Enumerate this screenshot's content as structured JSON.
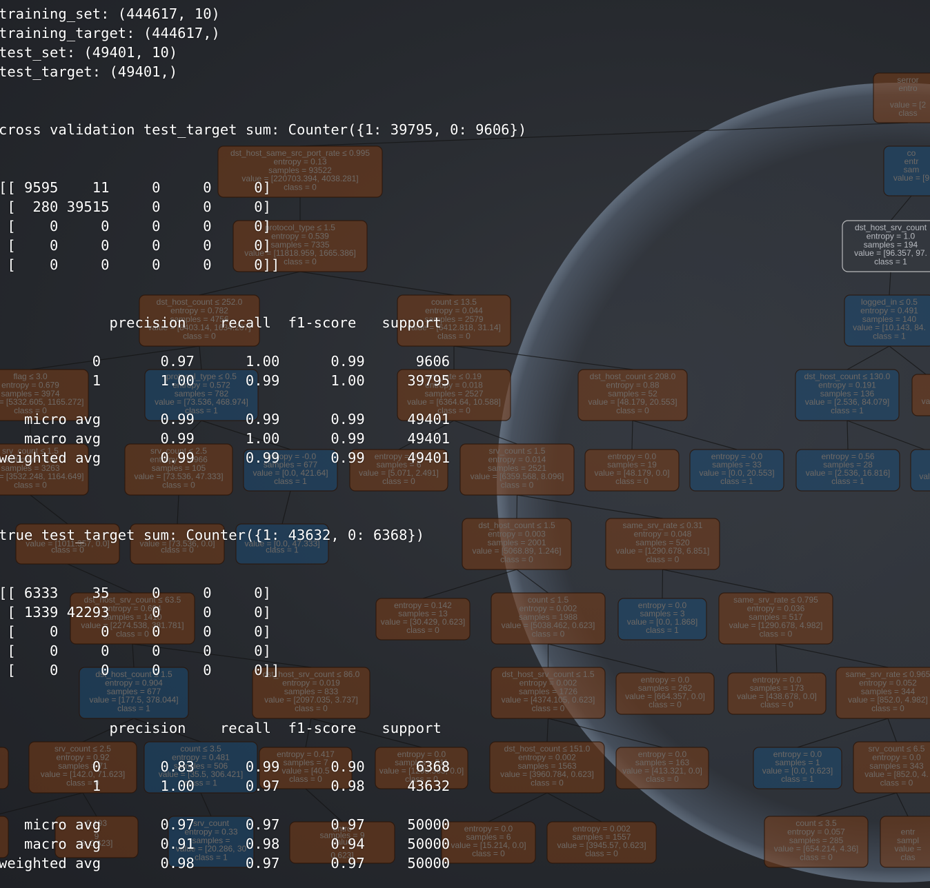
{
  "terminal": {
    "lines": [
      "training_set: (444617, 10)",
      "training_target: (444617,)",
      "test_set: (49401, 10)",
      "test_target: (49401,)",
      "",
      "",
      "cross validation test_target sum: Counter({1: 39795, 0: 9606})",
      "",
      "",
      "[[ 9595    11     0     0     0]",
      " [  280 39515     0     0     0]",
      " [    0     0     0     0     0]",
      " [    0     0     0     0     0]",
      " [    0     0     0     0     0]]",
      "",
      "",
      "             precision    recall  f1-score   support",
      "",
      "           0       0.97      1.00      0.99      9606",
      "           1       1.00      0.99      1.00     39795",
      "",
      "   micro avg       0.99      0.99      0.99     49401",
      "   macro avg       0.99      1.00      0.99     49401",
      "weighted avg       0.99      0.99      0.99     49401",
      "",
      "",
      "",
      "true test_target sum: Counter({1: 43632, 0: 6368})",
      "",
      "",
      "[[ 6333    35     0     0     0]",
      " [ 1339 42293     0     0     0]",
      " [    0     0     0     0     0]",
      " [    0     0     0     0     0]",
      " [    0     0     0     0     0]]",
      "",
      "",
      "             precision    recall  f1-score   support",
      "",
      "           0       0.83      0.99      0.90      6368",
      "           1       1.00      0.97      0.98     43632",
      "",
      "   micro avg       0.97      0.97      0.97     50000",
      "   macro avg       0.91      0.98      0.94     50000",
      "weighted avg       0.98      0.97      0.97     50000"
    ]
  },
  "colors": {
    "background": "#23262b",
    "text": "#ffffff",
    "node_orange": "#7a3d16",
    "node_blue": "#1c4a72",
    "node_white": "#dcdcdc",
    "edge": "#141414"
  },
  "background_tree": {
    "nodes": [
      {
        "color": "orange",
        "lines": [
          "serror",
          "entro",
          "",
          "value = [2",
          "class"
        ]
      },
      {
        "color": "orange",
        "lines": [
          "dst_host_same_src_port_rate ≤ 0.995",
          "entropy = 0.13",
          "samples = 93522",
          "value = [220703.394, 4038.281]",
          "class = 0"
        ]
      },
      {
        "color": "blue",
        "lines": [
          "co",
          "entr",
          "sam",
          "value = [9",
          ""
        ]
      },
      {
        "color": "orange",
        "lines": [
          "protocol_type ≤ 1.5",
          "entropy = 0.539",
          "samples = 7335",
          "value = [11818.959, 1665.386]",
          "class = 0"
        ]
      },
      {
        "color": "white",
        "lines": [
          "dst_host_srv_count",
          "entropy = 1.0",
          "samples = 194",
          "value = [96.357, 97.",
          "class = 1"
        ]
      },
      {
        "color": "orange",
        "lines": [
          "dst_host_count ≤ 252.0",
          "entropy = 0.782",
          "samples = 4756",
          "value = [8403.14, 1634.207]",
          "class = 0"
        ]
      },
      {
        "color": "orange",
        "lines": [
          "count ≤ 13.5",
          "entropy = 0.044",
          "samples = 2579",
          "value = [6412.818, 31.14]",
          "class = 0"
        ]
      },
      {
        "color": "blue",
        "lines": [
          "logged_in ≤ 0.5",
          "entropy = 0.491",
          "samples = 140",
          "value = [10.143, 84.",
          "class = 1"
        ]
      },
      {
        "color": "orange",
        "lines": [
          "flag ≤ 3.0",
          "entropy = 0.679",
          "samples = 3974",
          "value = [5332.605, 1165.272]",
          "class = 0"
        ]
      },
      {
        "color": "blue",
        "lines": [
          "protocol_type ≤ 0.5",
          "entropy = 0.572",
          "samples = 782",
          "value = [73.536, 468.974]",
          "class = 1"
        ]
      },
      {
        "color": "orange",
        "lines": [
          "srv_rate ≤ 0.19",
          "entropy = 0.018",
          "samples = 2527",
          "value = [6364.64, 10.588]",
          "class = 0"
        ]
      },
      {
        "color": "orange",
        "lines": [
          "dst_host_count ≤ 208.0",
          "entropy = 0.88",
          "samples = 52",
          "value = [48.179, 20.553]",
          "class = 0"
        ]
      },
      {
        "color": "blue",
        "lines": [
          "dst_host_count ≤ 130.0",
          "entropy = 0.191",
          "samples = 136",
          "value = [2.536, 84.079]",
          "class = 1"
        ]
      },
      {
        "color": "orange",
        "lines": [
          "",
          "",
          "",
          "va",
          ""
        ]
      },
      {
        "color": "orange",
        "lines": [
          "srv_count ≤ 1.5",
          "entropy = 0.5",
          "samples = 3263",
          "value = [3532.248, 1164.649]",
          "class = 0"
        ]
      },
      {
        "color": "orange",
        "lines": [
          "srv_count ≤ 2.5",
          "entropy = 0.966",
          "samples = 105",
          "value = [73.536, 47.333]",
          "class = 0"
        ]
      },
      {
        "color": "blue",
        "lines": [
          "entropy = -0.0",
          "samples = 677",
          "value = [0.0, 421.64]",
          "class = 1"
        ]
      },
      {
        "color": "orange",
        "lines": [
          "entropy = 0.0",
          "samples = 6",
          "value = [5.071, 2.491]",
          "class = 0"
        ]
      },
      {
        "color": "orange",
        "lines": [
          "srv_count ≤ 1.5",
          "entropy = 0.014",
          "samples = 2521",
          "value = [6359.568, 8.096]",
          "class = 0"
        ]
      },
      {
        "color": "orange",
        "lines": [
          "entropy = 0.0",
          "samples = 19",
          "value = [48.179, 0.0]",
          "class = 0"
        ]
      },
      {
        "color": "blue",
        "lines": [
          "entropy = -0.0",
          "samples = 33",
          "value = [0.0, 20.553]",
          "class = 1"
        ]
      },
      {
        "color": "blue",
        "lines": [
          "entropy = 0.56",
          "samples = 28",
          "value = [2.536, 16.816]",
          "class = 1"
        ]
      },
      {
        "color": "blue",
        "lines": [
          "",
          "",
          "",
          "val",
          ""
        ]
      },
      {
        "color": "orange",
        "lines": [
          "",
          "",
          "value = [1011.357, 0.0]",
          "class = 0",
          ""
        ]
      },
      {
        "color": "orange",
        "lines": [
          "",
          "",
          "value = [73.536, 0.0]",
          "class = 0",
          ""
        ]
      },
      {
        "color": "blue",
        "lines": [
          "",
          "",
          "value = [0.0, 47.333]",
          "class = 1",
          ""
        ]
      },
      {
        "color": "orange",
        "lines": [
          "dst_host_count ≤ 1.5",
          "entropy = 0.003",
          "samples = 2001",
          "value = [5068.89, 1.246]",
          "class = 0"
        ]
      },
      {
        "color": "orange",
        "lines": [
          "same_srv_rate ≤ 0.31",
          "entropy = 0.048",
          "samples = 520",
          "value = [1290.678, 6.851]",
          "class = 0"
        ]
      },
      {
        "color": "orange",
        "lines": [
          "dst_host_srv_count ≤ 63.5",
          "entropy = 0.694",
          "samples = 1410",
          "value = [2274.538, 381.781]",
          "class = 0"
        ]
      },
      {
        "color": "orange",
        "lines": [
          "entropy = 0.142",
          "samples = 13",
          "value = [30.429, 0.623]",
          "class = 0"
        ]
      },
      {
        "color": "orange",
        "lines": [
          "count ≤ 1.5",
          "entropy = 0.002",
          "samples = 1988",
          "value = [5038.462, 0.623]",
          "class = 0"
        ]
      },
      {
        "color": "blue",
        "lines": [
          "entropy = 0.0",
          "samples = 3",
          "value = [0.0, 1.868]",
          "class = 1"
        ]
      },
      {
        "color": "orange",
        "lines": [
          "same_srv_rate ≤ 0.795",
          "entropy = 0.036",
          "samples = 517",
          "value = [1290.678, 4.982]",
          "class = 0"
        ]
      },
      {
        "color": "blue",
        "lines": [
          "dst_host_count ≤ 1.5",
          "entropy = 0.904",
          "samples = 677",
          "value = [177.5, 378.044]",
          "class = 1"
        ]
      },
      {
        "color": "orange",
        "lines": [
          "dst_host_srv_count ≤ 86.0",
          "entropy = 0.019",
          "samples = 833",
          "value = [2097.035, 3.737]",
          "class = 0"
        ]
      },
      {
        "color": "orange",
        "lines": [
          "dst_host_srv_count ≤ 1.5",
          "entropy = 0.002",
          "samples = 1726",
          "value = [4374.105, 0.623]",
          "class = 0"
        ]
      },
      {
        "color": "orange",
        "lines": [
          "entropy = 0.0",
          "samples = 262",
          "value = [664.357, 0.0]",
          "class = 0"
        ]
      },
      {
        "color": "orange",
        "lines": [
          "entropy = 0.0",
          "samples = 173",
          "value = [438.678, 0.0]",
          "class = 0"
        ]
      },
      {
        "color": "orange",
        "lines": [
          "same_srv_rate ≤ 0.965",
          "entropy = 0.052",
          "samples = 344",
          "value = [852.0, 4.982]",
          "class = 0"
        ]
      },
      {
        "color": "orange",
        "lines": [
          "",
          "",
          "",
          "0]",
          ""
        ]
      },
      {
        "color": "orange",
        "lines": [
          "srv_count ≤ 2.5",
          "entropy = 0.92",
          "samples = 71",
          "value = [142.0, 71.623]",
          "class = 0"
        ]
      },
      {
        "color": "blue",
        "lines": [
          "count ≤ 3.5",
          "entropy = 0.481",
          "samples = 506",
          "value = [35.5, 306.421]",
          "class = 1"
        ]
      },
      {
        "color": "orange",
        "lines": [
          "entropy = 0.417",
          "samples = 7",
          "value = [40.5",
          "class = 0"
        ]
      },
      {
        "color": "orange",
        "lines": [
          "entropy = 0.0",
          "samples = 511",
          "value = [1295.363, 0.0]",
          "class = 0"
        ]
      },
      {
        "color": "orange",
        "lines": [
          "dst_host_count ≤ 151.0",
          "entropy = 0.002",
          "samples = 1563",
          "value = [3960.784, 0.623]",
          "class = 0"
        ]
      },
      {
        "color": "orange",
        "lines": [
          "entropy = 0.0",
          "samples = 163",
          "value = [413.321, 0.0]",
          "class = 0"
        ]
      },
      {
        "color": "blue",
        "lines": [
          "entropy = 0.0",
          "samples = 1",
          "value = [0.0, 0.623]",
          "class = 1"
        ]
      },
      {
        "color": "orange",
        "lines": [
          "srv_count ≤ 6.5",
          "entropy = 0.0",
          "samples = 343",
          "value = [852.0, 4.",
          "class = 0"
        ]
      },
      {
        "color": "orange",
        "lines": [
          "7.0",
          "",
          "",
          "0]",
          ""
        ]
      },
      {
        "color": "orange",
        "lines": [
          "0.193",
          "",
          "9",
          "6, 0.623]",
          ""
        ]
      },
      {
        "color": "blue",
        "lines": [
          "srv_count",
          "entropy = 0.33",
          "samples = ",
          "value = [20.286, 30",
          "class = 1"
        ]
      },
      {
        "color": "orange",
        "lines": [
          "entro",
          "samples = 9",
          "value",
          "",
          "0.623]"
        ]
      },
      {
        "color": "orange",
        "lines": [
          "entropy = 0.0",
          "samples = 6",
          "value = [15.214, 0.0]",
          "class = 0"
        ]
      },
      {
        "color": "orange",
        "lines": [
          "entropy = 0.002",
          "samples = 1557",
          "value = [3945.57, 0.623]",
          "class = 0"
        ]
      },
      {
        "color": "orange",
        "lines": [
          "count ≤ 3.5",
          "entropy = 0.057",
          "samples = 285",
          "value = [654.214, 4.36]",
          "class = 0"
        ]
      },
      {
        "color": "orange",
        "lines": [
          "",
          "entr",
          "sampl",
          "value =",
          "clas"
        ]
      }
    ]
  }
}
